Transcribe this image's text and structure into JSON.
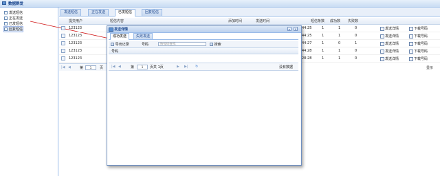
{
  "panel": {
    "title": "数据群发"
  },
  "sidebar": {
    "items": [
      {
        "label": "发送短信"
      },
      {
        "label": "正在发送"
      },
      {
        "label": "已发短信"
      },
      {
        "label": "回复短信"
      }
    ]
  },
  "tabs": [
    {
      "label": "发送短信"
    },
    {
      "label": "正在发送"
    },
    {
      "label": "已发短信"
    },
    {
      "label": "回复短信"
    }
  ],
  "grid": {
    "columns": [
      "提交用户",
      "短信内容",
      "添加时间",
      "发送时间",
      "短信条数",
      "成功数",
      "失败数"
    ],
    "rows": [
      {
        "user": "123123",
        "time": "44:25",
        "count": "1",
        "success": "1",
        "fail": "0"
      },
      {
        "user": "123123",
        "time": "44:25",
        "count": "1",
        "success": "1",
        "fail": "0"
      },
      {
        "user": "123123",
        "time": "44:27",
        "count": "1",
        "success": "0",
        "fail": "1"
      },
      {
        "user": "123123",
        "time": "44:28",
        "count": "1",
        "success": "1",
        "fail": "0"
      },
      {
        "user": "123123",
        "time": "28:28",
        "count": "1",
        "success": "1",
        "fail": "0"
      }
    ],
    "actions": {
      "detail": "发送详情",
      "download": "下载号码"
    }
  },
  "pager": {
    "page": "1",
    "page_label": "第",
    "of_label": "页",
    "display": "显示"
  },
  "modal": {
    "title": "发送详情",
    "tabs": [
      {
        "label": "成功发送"
      },
      {
        "label": "失败发送"
      }
    ],
    "toolbar": {
      "export": "导出记录",
      "phone_label": "号码",
      "placeholder": "按号码查找",
      "search": "搜索"
    },
    "columns": [
      "号码"
    ],
    "pager": {
      "prefix": "第",
      "page": "1",
      "total": "页共 1页",
      "status": "没有数据"
    }
  }
}
